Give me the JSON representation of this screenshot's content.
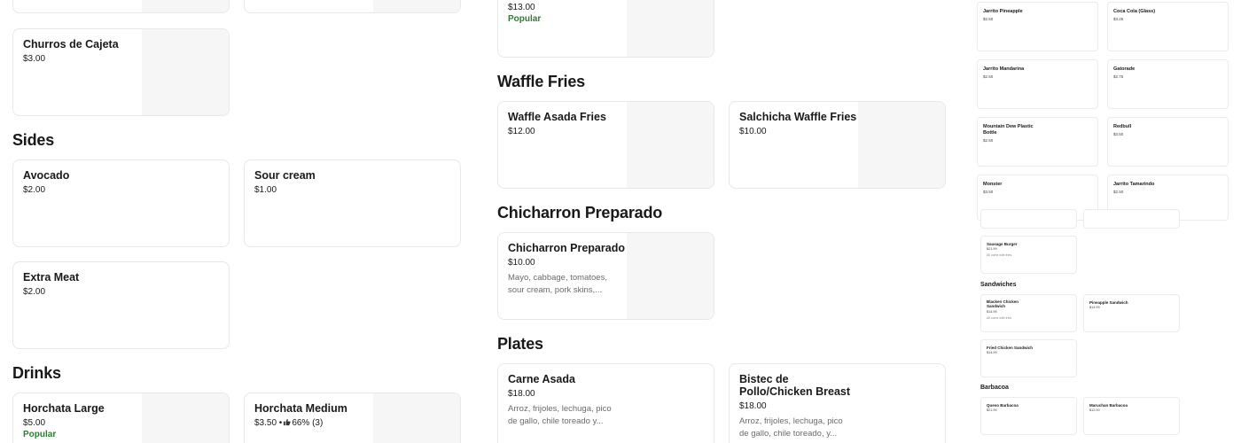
{
  "left": {
    "top_prices": [],
    "cards": [
      {
        "name": "Churros de Cajeta",
        "price": "$3.00"
      },
      {
        "name": "Avocado",
        "price": "$2.00"
      },
      {
        "name": "Sour cream",
        "price": "$1.00"
      },
      {
        "name": "Extra Meat",
        "price": "$2.00"
      },
      {
        "name": "Horchata Large",
        "price": "$5.00",
        "badge": "Popular"
      },
      {
        "name": "Horchata Medium",
        "price": "$3.50 •",
        "rating": "66% (3)"
      }
    ],
    "headings": {
      "sides": "Sides",
      "drinks": "Drinks"
    }
  },
  "middle": {
    "top_card": {
      "price": "$13.00",
      "badge": "Popular"
    },
    "headings": {
      "waffle": "Waffle Fries",
      "chicharron": "Chicharron Preparado",
      "plates": "Plates"
    },
    "cards": [
      {
        "name": "Waffle Asada Fries",
        "price": "$12.00"
      },
      {
        "name": "Salchicha Waffle Fries",
        "price": "$10.00"
      },
      {
        "name": "Chicharron Preparado",
        "price": "$10.00",
        "desc": "Mayo, cabbage, tomatoes, sour cream, pork skins,..."
      },
      {
        "name": "Carne Asada",
        "price": "$18.00",
        "desc": "Arroz, frijoles, lechuga, pico de gallo, chile toreado y..."
      },
      {
        "name": "Bistec de Pollo/Chicken Breast",
        "price": "$18.00",
        "desc": "Arroz, frijoles, lechuga, pico de gallo, chile toreado, y..."
      }
    ]
  },
  "right": {
    "drinks": [
      {
        "name": "Jarrito Pineapple",
        "price": "$2.50"
      },
      {
        "name": "Coca Cola (Glass)",
        "price": "$3.25"
      },
      {
        "name": "Jarrito Mandarina",
        "price": "$2.50"
      },
      {
        "name": "Gatorade",
        "price": "$2.75"
      },
      {
        "name": "Mountain Dew Plastic Bottle",
        "price": "$2.50"
      },
      {
        "name": "Redbull",
        "price": "$3.50"
      },
      {
        "name": "Monster",
        "price": "$3.50"
      },
      {
        "name": "Jarrito Tamarindo",
        "price": "$2.50"
      }
    ],
    "mini": {
      "burger": {
        "name": "Sausage Burger",
        "price": "$21.99",
        "desc": "All come with fries"
      },
      "sandwiches_heading": "Sandwiches",
      "sandwiches": [
        {
          "name": "Blacken Chicken Sandwich",
          "price": "$14.99",
          "desc": "All come with fries"
        },
        {
          "name": "Pineapple Sandwich",
          "price": "$14.99"
        },
        {
          "name": "Fried Chicken Sandwich",
          "price": "$14.99"
        }
      ],
      "barbacoa_heading": "Barbacoa",
      "barbacoa": [
        {
          "name": "Queso Barbacoa",
          "price": "$21.99"
        },
        {
          "name": "Maruchan Barbacoa",
          "price": "$12.00"
        }
      ]
    }
  }
}
